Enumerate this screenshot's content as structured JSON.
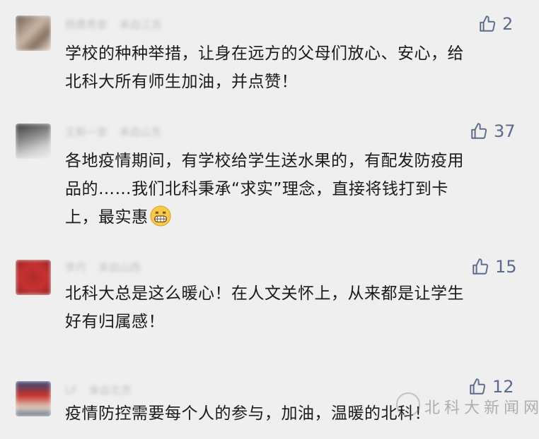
{
  "comments": [
    {
      "name": "杨惠秀家",
      "location": "来自江苏",
      "likes": "2",
      "text_lines": [
        "学校的种种举措，让身在远方的父母们放心、安心，给",
        "北科大所有师生加油，并点赞！"
      ]
    },
    {
      "name": "王新一家",
      "location": "来自山东",
      "likes": "37",
      "text_lines": [
        "各地疫情期间，有学校给学生送水果的，有配发防疫用",
        "品的……我们北科秉承“求实”理念，直接将钱打到卡",
        "上，最实惠"
      ]
    },
    {
      "name": "李丹",
      "location": "来自山西",
      "likes": "15",
      "text_lines": [
        "北科大总是这么暖心！在人文关怀上，从来都是让学生",
        "好有归属感！"
      ]
    },
    {
      "name": "LF",
      "location": "来自北京",
      "likes": "12",
      "text_lines": [
        "疫情防控需要每个人的参与，加油，温暖的北科！"
      ]
    }
  ],
  "watermark": {
    "text": "北科大新闻网"
  },
  "icons": {
    "like": "thumbs-up-icon",
    "emoji": "grinning-face-icon"
  },
  "colors": {
    "background": "#efefef",
    "like": "#5b6b8c",
    "text": "#1a1a1a"
  }
}
